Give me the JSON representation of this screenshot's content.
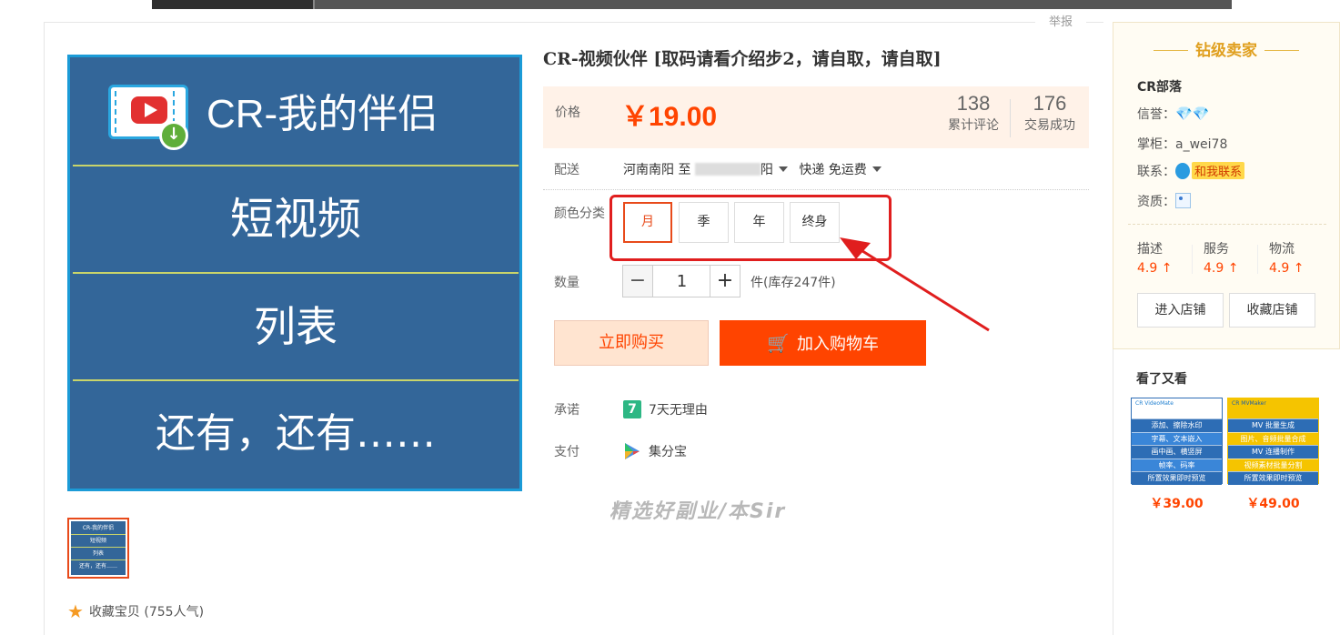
{
  "report_label": "举报",
  "product": {
    "title": "CR-视频伙伴 [取码请看介绍步2，请自取，请自取]",
    "image_text": {
      "app_name": "CR-我的伴侣",
      "row2": "短视频",
      "row3": "列表",
      "row4": "还有，还有……"
    },
    "thumb_text": [
      "CR-我的伴侣",
      "短视频",
      "列表",
      "还有，还有……"
    ],
    "favorite": "收藏宝贝 (755人气)"
  },
  "price": {
    "label": "价格",
    "value": "￥19.00",
    "reviews_count": "138",
    "reviews_label": "累计评论",
    "sold_count": "176",
    "sold_label": "交易成功"
  },
  "shipping": {
    "label": "配送",
    "from": "河南南阳 至",
    "to_suffix": "阳",
    "method": "快递 免运费"
  },
  "sku": {
    "label": "颜色分类",
    "options": [
      "月",
      "季",
      "年",
      "终身"
    ],
    "selected": "月"
  },
  "quantity": {
    "label": "数量",
    "minus": "−",
    "value": "1",
    "plus": "+",
    "stock": "件(库存247件)"
  },
  "actions": {
    "buy_now": "立即购买",
    "add_to_cart": "加入购物车"
  },
  "promise": {
    "label": "承诺",
    "icon_text": "7",
    "value": "7天无理由"
  },
  "payment": {
    "label": "支付",
    "value": "集分宝"
  },
  "watermark": "精选好副业/本Sir",
  "seller": {
    "level": "钻级卖家",
    "name": "CR部落",
    "credit_label": "信誉：",
    "keeper_label": "掌柜：",
    "keeper": "a_wei78",
    "contact_label": "联系：",
    "contact_button": "和我联系",
    "qualification_label": "资质：",
    "scores": [
      {
        "key": "描述",
        "value": "4.9 ↑"
      },
      {
        "key": "服务",
        "value": "4.9 ↑"
      },
      {
        "key": "物流",
        "value": "4.9 ↑"
      }
    ],
    "enter_shop": "进入店铺",
    "favorite_shop": "收藏店铺"
  },
  "also_viewed": {
    "title": "看了又看",
    "items": [
      {
        "header": "CR VideoMate",
        "rows": [
          "添加、擦除水印",
          "字幕、文本嵌入",
          "画中画、横竖屏",
          "帧率、码率",
          "所置效果即时预览"
        ],
        "price": "￥39.00"
      },
      {
        "header": "CR MVMaker",
        "rows": [
          "MV 批量生成",
          "图片、音频批量合成",
          "MV 连播制作",
          "视频素材批量分割",
          "所置效果即时预览"
        ],
        "price": "￥49.00"
      }
    ]
  },
  "colors": {
    "accent": "#ff4400",
    "image_bg": "#336699",
    "annotation": "#e01e1e",
    "seller_gold": "#e0a020"
  }
}
